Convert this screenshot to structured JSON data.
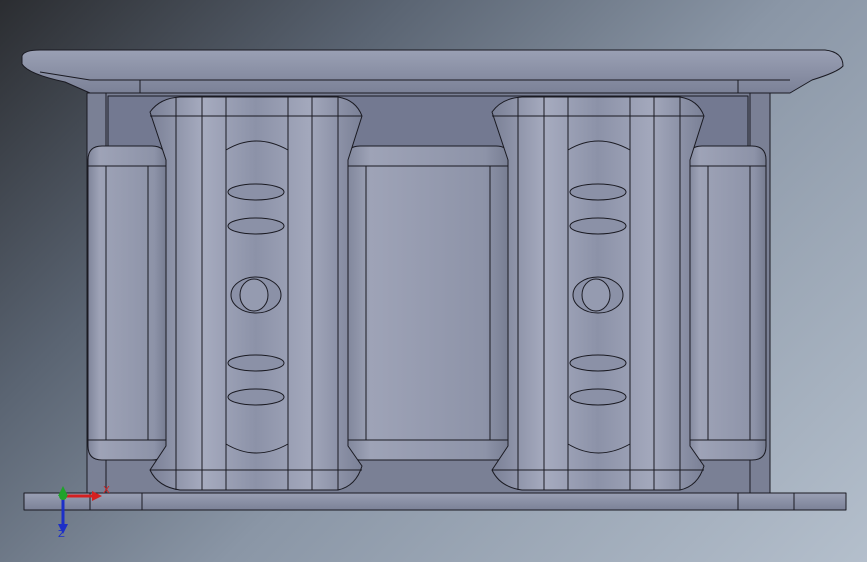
{
  "viewport": {
    "background_top": "#2b2d31",
    "background_bottom": "#b4bfcc"
  },
  "model": {
    "face_color": "#8a90a6",
    "edge_color": "#1a1a22",
    "highlight_color": "#a7acc0",
    "shadow_color": "#6f7489"
  },
  "triad": {
    "x_label": "X",
    "z_label": "Z",
    "x_color": "#d42020",
    "y_color": "#1fa32a",
    "z_color": "#1c2fc8"
  }
}
